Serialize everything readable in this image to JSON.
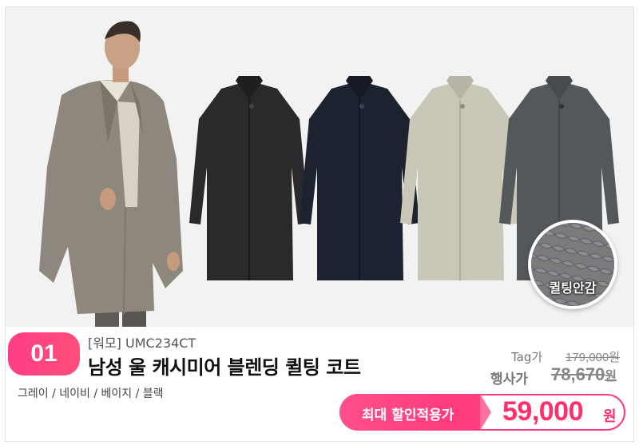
{
  "product": {
    "number": "01",
    "brand_code": "[워모] UMC234CT",
    "name": "남성 울 캐시미어 블렌딩 퀼팅 코트",
    "colors": "그레이 / 네이비 / 베이지 / 블랙",
    "quilting_label": "퀼팅안감"
  },
  "pricing": {
    "tag_label": "Tag가",
    "tag_price": "179,000원",
    "event_label": "행사가",
    "event_price": "78,670",
    "event_unit": "원",
    "sale_label": "최대 할인적용가",
    "sale_price": "59,000",
    "sale_unit": "원"
  },
  "coats": [
    {
      "color": "black",
      "hex": "#2a2a2c"
    },
    {
      "color": "navy",
      "hex": "#1c2230"
    },
    {
      "color": "beige",
      "hex": "#c9c7b8"
    },
    {
      "color": "gray",
      "hex": "#55585b"
    }
  ],
  "theme": {
    "accent": "#ff3b7e",
    "accent_text": "#ff2f6e"
  }
}
